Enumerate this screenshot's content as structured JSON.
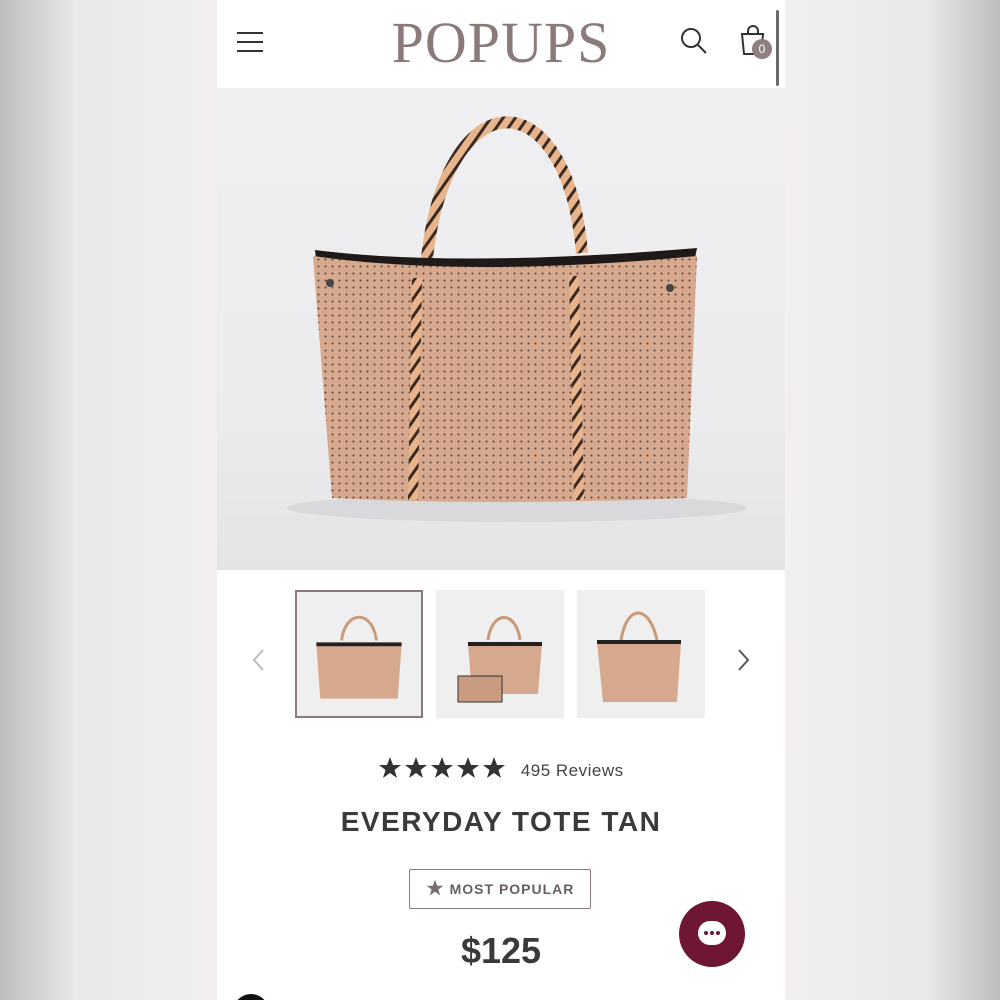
{
  "header": {
    "brand": "POPUPS",
    "cart_count": "0"
  },
  "product": {
    "rating_stars": 5,
    "reviews_label": "495 Reviews",
    "title": "EVERYDAY TOTE TAN",
    "badge": "MOST POPULAR",
    "price": "$125"
  },
  "gallery": {
    "thumbnails": [
      "tote-front",
      "tote-with-pouch",
      "tote-side"
    ],
    "active_index": 0
  },
  "colors": {
    "brand": "#8a7b7a",
    "chat_button": "#6e1634",
    "tote_tan": "#d6a98e"
  },
  "icons": {
    "menu": "hamburger-icon",
    "search": "search-icon",
    "cart": "cart-icon",
    "prev": "chevron-left-icon",
    "next": "chevron-right-icon",
    "star": "star-icon",
    "chat": "chat-icon"
  }
}
